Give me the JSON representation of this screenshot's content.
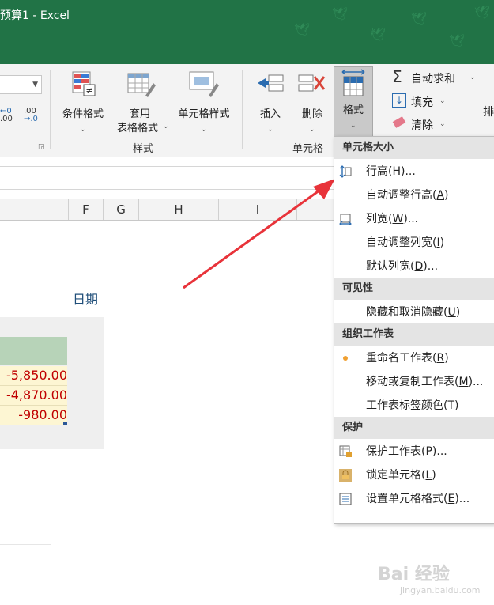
{
  "window": {
    "title": "预算1  -  Excel"
  },
  "ribbon": {
    "number_formats": [
      ".00",
      ".0"
    ],
    "conditional_format": {
      "label": "条件格式",
      "icon": "conditional-format-icon"
    },
    "format_as_table": {
      "line1": "套用",
      "line2": "表格格式",
      "icon": "table-format-icon"
    },
    "cell_styles": {
      "label": "单元格样式",
      "icon": "cell-styles-icon"
    },
    "styles_group": "样式",
    "insert": {
      "label": "插入",
      "icon": "insert-cells-icon"
    },
    "delete": {
      "label": "删除",
      "icon": "delete-cells-icon"
    },
    "format": {
      "label": "格式",
      "icon": "format-cells-icon"
    },
    "cells_group": "单元格",
    "autosum": {
      "label": "自动求和",
      "icon": "sigma-icon"
    },
    "fill": {
      "label": "填充",
      "icon": "fill-down-icon"
    },
    "clear": {
      "label": "清除",
      "icon": "eraser-icon"
    },
    "sort_partial": "排"
  },
  "grid": {
    "columns": [
      "F",
      "G",
      "H",
      "I"
    ],
    "header_label": "日期",
    "values": [
      "-5,850.00",
      "-4,870.00",
      "-980.00"
    ],
    "value_color": "#c00000",
    "highlight_color": "#fdf6d3",
    "table_header_color": "#b7d3b8"
  },
  "format_menu": {
    "sections": [
      {
        "title": "单元格大小",
        "items": [
          {
            "label": "行高",
            "key": "H",
            "suffix": "...",
            "icon": "row-height-icon"
          },
          {
            "label": "自动调整行高",
            "key": "A",
            "suffix": ""
          },
          {
            "label": "列宽",
            "key": "W",
            "suffix": "...",
            "icon": "column-width-icon"
          },
          {
            "label": "自动调整列宽",
            "key": "I",
            "suffix": ""
          },
          {
            "label": "默认列宽",
            "key": "D",
            "suffix": "..."
          }
        ]
      },
      {
        "title": "可见性",
        "items": [
          {
            "label": "隐藏和取消隐藏",
            "key": "U",
            "suffix": ""
          }
        ]
      },
      {
        "title": "组织工作表",
        "items": [
          {
            "label": "重命名工作表",
            "key": "R",
            "suffix": "",
            "icon": "rename-dot-icon"
          },
          {
            "label": "移动或复制工作表",
            "key": "M",
            "suffix": "..."
          },
          {
            "label": "工作表标签颜色",
            "key": "T",
            "suffix": ""
          }
        ]
      },
      {
        "title": "保护",
        "items": [
          {
            "label": "保护工作表",
            "key": "P",
            "suffix": "...",
            "icon": "protect-sheet-icon"
          },
          {
            "label": "锁定单元格",
            "key": "L",
            "suffix": "",
            "icon": "lock-cell-icon"
          },
          {
            "label": "设置单元格格式",
            "key": "E",
            "suffix": "...",
            "icon": "format-cells-dialog-icon"
          }
        ]
      }
    ]
  },
  "watermark": {
    "brand": "Bai 经验",
    "url": "jingyan.baidu.com"
  },
  "colors": {
    "excel_green": "#217346",
    "arrow_red": "#e8333a",
    "ribbon_bg": "#f3f3f3"
  }
}
